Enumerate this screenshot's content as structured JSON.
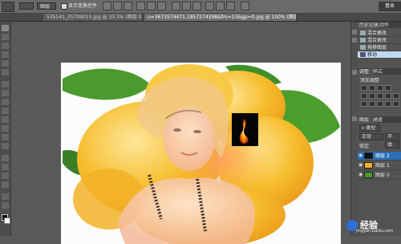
{
  "options_bar": {
    "layer_select": "图层",
    "show_transform_label": "显示变换控件",
    "mode_label": "基本"
  },
  "tabs": [
    {
      "label": "535541_25709015.jpg @ 33.3% (图层 0, RGB/8#)",
      "active": false
    },
    {
      "label": "u=3673574471,1857274398&fm=23&gp=0.jpg @ 100% (图层 1, RGB/8#)",
      "active": true
    }
  ],
  "history_panel": {
    "tabs": [
      "历史记录",
      "动作"
    ],
    "items": [
      {
        "label": "混合更改",
        "selected": false
      },
      {
        "label": "混合更改",
        "selected": false
      },
      {
        "label": "拖移图层",
        "selected": false
      },
      {
        "label": "移动",
        "selected": true
      }
    ]
  },
  "adjustments_panel": {
    "tabs": [
      "调整",
      "样式"
    ],
    "title": "添加调整"
  },
  "layers_panel": {
    "tabs": [
      "图层",
      "通道"
    ],
    "filter_label": "类型",
    "blend_mode": "正常",
    "lock_label": "锁定",
    "opacity_short": "不",
    "fill_short": "填",
    "layers": [
      {
        "name": "图层 2",
        "selected": true
      },
      {
        "name": "图层 1",
        "selected": false
      },
      {
        "name": "图层 0",
        "selected": false
      }
    ]
  },
  "watermark": {
    "text": "经验",
    "sub": "jingyan.baidu.com"
  },
  "colors": {
    "selection": "#2d6fb3",
    "history_selected": "#bfd9f2",
    "flower": "#f4b41a",
    "leaf": "#3f8f2a"
  }
}
